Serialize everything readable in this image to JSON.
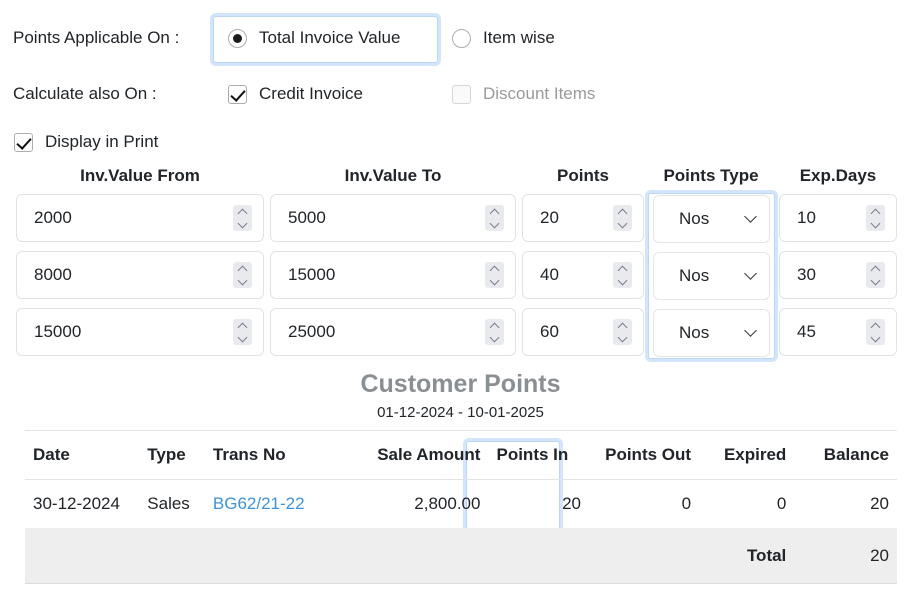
{
  "options": {
    "points_applicable_label": "Points Applicable On :",
    "points_applicable_choices": [
      {
        "label": "Total Invoice Value",
        "selected": true,
        "highlighted": true
      },
      {
        "label": "Item wise",
        "selected": false,
        "highlighted": false
      }
    ],
    "calculate_also_label": "Calculate also On :",
    "calculate_also_choices": [
      {
        "label": "Credit Invoice",
        "checked": true,
        "disabled": false
      },
      {
        "label": "Discount Items",
        "checked": false,
        "disabled": true
      }
    ],
    "display_in_print": {
      "label": "Display in Print",
      "checked": true
    }
  },
  "slab_table": {
    "headers": [
      "Inv.Value From",
      "Inv.Value To",
      "Points",
      "Points Type",
      "Exp.Days"
    ],
    "highlighted_column": "Points Type",
    "rows": [
      {
        "inv_value_from": "2000",
        "inv_value_to": "5000",
        "points": "20",
        "points_type": "Nos",
        "exp_days": "10"
      },
      {
        "inv_value_from": "8000",
        "inv_value_to": "15000",
        "points": "40",
        "points_type": "Nos",
        "exp_days": "30"
      },
      {
        "inv_value_from": "15000",
        "inv_value_to": "25000",
        "points": "60",
        "points_type": "Nos",
        "exp_days": "45"
      }
    ]
  },
  "customer_points": {
    "title": "Customer Points",
    "date_range": "01-12-2024 - 10-01-2025",
    "headers": [
      "Date",
      "Type",
      "Trans No",
      "Sale Amount",
      "Points In",
      "Points Out",
      "Expired",
      "Balance"
    ],
    "highlighted_column": "Points In",
    "rows": [
      {
        "date": "30-12-2024",
        "type": "Sales",
        "trans_no": "BG62/21-22",
        "sale_amount": "2,800.00",
        "points_in": "20",
        "points_out": "0",
        "expired": "0",
        "balance": "20"
      }
    ],
    "total_label": "Total",
    "total_value": "20"
  },
  "colors": {
    "link": "#3d93d8",
    "highlight_border": "#bcd6f5",
    "highlight_glow": "rgba(108,168,240,0.30)",
    "title_grey": "#8a8f94",
    "total_row_bg": "#eeeeee"
  }
}
